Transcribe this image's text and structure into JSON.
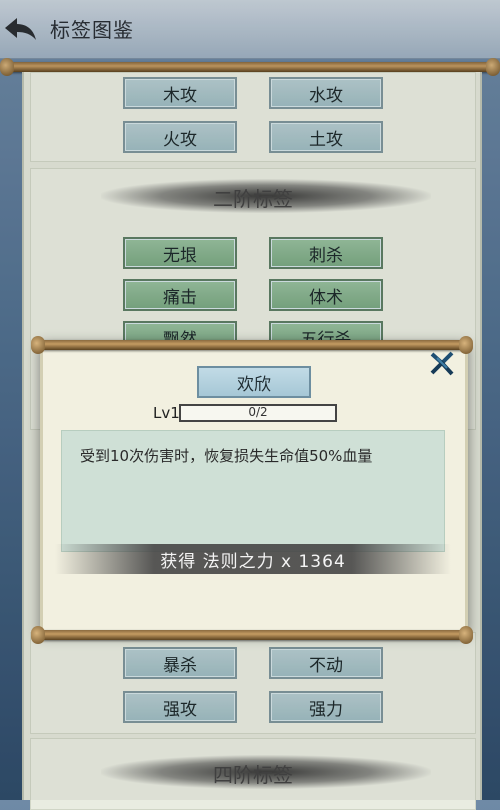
{
  "header": {
    "title": "标签图鉴"
  },
  "stages": [
    {
      "title": "",
      "tags": [
        "木攻",
        "水攻",
        "火攻",
        "土攻"
      ]
    },
    {
      "title": "二阶标签",
      "tags": [
        "无垠",
        "刺杀",
        "痛击",
        "体术",
        "飘然",
        "五行杀"
      ]
    },
    {
      "title": "",
      "tags": [
        "暴杀",
        "不动",
        "强攻",
        "强力"
      ]
    },
    {
      "title": "四阶标签"
    }
  ],
  "dialog": {
    "tag_name": "欢欣",
    "level_label": "Lv1",
    "progress_text": "0/2",
    "progress_fraction": 0,
    "description": "受到10次伤害时，恢复损失生命值50%血量",
    "reward_text": "获得 法则之力 x 1364"
  }
}
